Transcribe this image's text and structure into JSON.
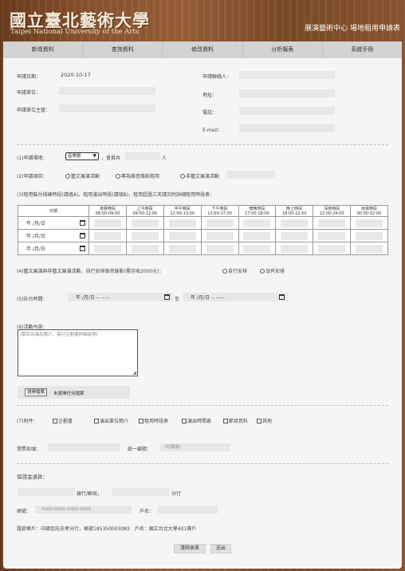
{
  "header": {
    "logo_cn": "國立臺北藝術大學",
    "logo_en": "Taipei National University of the Arts",
    "site_title": "展演藝術中心 場地租用申請表"
  },
  "nav": [
    "新增資料",
    "查詢資料",
    "修改資料",
    "分析報表",
    "系統手冊"
  ],
  "applicant": {
    "date_label": "申請日期：",
    "date_value": "2020-10-17",
    "unit_label": "申請單位：",
    "head_label": "申請單位主管：",
    "contact_label": "申請聯絡人：",
    "address_label": "地址：",
    "phone_label": "電話：",
    "email_label": "E-mail："
  },
  "venue": {
    "label": "(1)申請場地：",
    "select_value": "音樂廳",
    "mid": "，會員共",
    "unit": "人"
  },
  "project": {
    "label": "(2)申請項目：",
    "opt1": "藝文展演活動",
    "opt2": "專為錄音錄影租用",
    "opt3": "非藝文展演活動"
  },
  "schedule": {
    "label": "(3)租用裝台排練時段(請填A)，租用演出時段(請填B)，租用超過三天請另附詳細租用時段表：",
    "date_header": "日期",
    "columns": [
      {
        "name": "凌晨時段",
        "time": "08:00-09:00"
      },
      {
        "name": "上午時段",
        "time": "09:00-12:00"
      },
      {
        "name": "中午時段",
        "time": "12:00-13:00"
      },
      {
        "name": "下午時段",
        "time": "13:00-17:00"
      },
      {
        "name": "傍晚時段",
        "time": "17:00-18:00"
      },
      {
        "name": "晚上時段",
        "time": "18:00-22:00"
      },
      {
        "name": "深夜時段",
        "time": "22:00-24:00"
      },
      {
        "name": "凌晨時段",
        "time": "00:00-02:00"
      }
    ],
    "date_placeholder": "年 /月/日"
  },
  "recording": {
    "label": "(4)藝文展演與非藝文展演活動，自行安排錄音錄影(需另收2000元)：",
    "opt1": "自行安排",
    "opt2": "沒有安排"
  },
  "load_in": {
    "label": "(5)拆台時間：",
    "placeholder": "年 /月/日  -- --:--",
    "to": "至"
  },
  "content": {
    "label": "(6)活動內容：",
    "placeholder": "(節目名稱及簡介，需付企劃書詳細說明)"
  },
  "upload": {
    "button": "選擇檔案",
    "status": "未選擇任何檔案"
  },
  "attachments": {
    "label": "(7)附件：",
    "items": [
      "企劃書",
      "演出單位簡介",
      "租用時段表",
      "演出時間表",
      "節目資料",
      "其他"
    ]
  },
  "invoice": {
    "title_label": "發票抬頭：",
    "tax_label": "統一編號：",
    "tax_placeholder": "(可選填)"
  },
  "deposit": {
    "title": "保證金退款：",
    "bank_label": "銀行/郵局，",
    "branch_label": "分行",
    "account_label": "帳號：",
    "account_placeholder": "0000-0000-0000-0000",
    "name_label": "戶名：",
    "remit_note": "匯款帳戶：中國信託忠孝分行，帳號185350003083　戶名：國立台北大學401專戶"
  },
  "actions": {
    "clear": "清除表單",
    "submit": "送出"
  }
}
